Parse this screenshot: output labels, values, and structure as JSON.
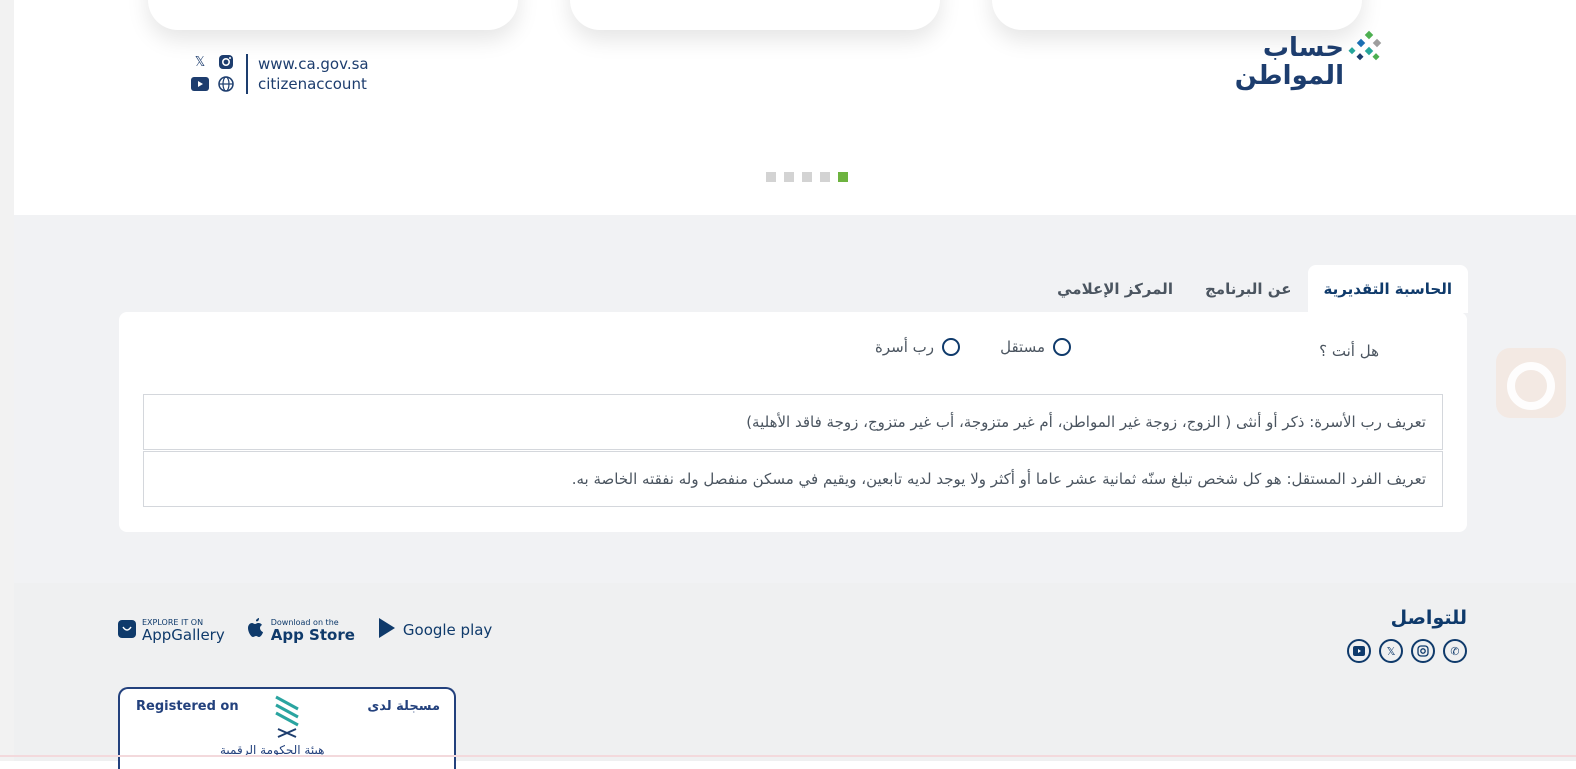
{
  "hero": {
    "brand_logo": {
      "icon": "citizen-account-logo",
      "line1": "حساب",
      "line2": "المواطن"
    },
    "social_links": {
      "icons": [
        "x-icon",
        "instagram-icon",
        "youtube-icon",
        "globe-icon"
      ],
      "url": "www.ca.gov.sa",
      "handle": "citizenaccount"
    },
    "carousel": {
      "count": 5,
      "active_index": 4,
      "active_color": "#6db33f",
      "inactive_color": "#d3d3d3"
    }
  },
  "tabs": {
    "items": [
      {
        "label": "الحاسبة التقديرية",
        "active": true
      },
      {
        "label": "عن البرنامج",
        "active": false
      },
      {
        "label": "المركز الإعلامي",
        "active": false
      }
    ]
  },
  "calculator": {
    "question": "هل أنت ؟",
    "options": [
      {
        "label": "مستقل",
        "selected": false
      },
      {
        "label": "رب أسرة",
        "selected": false
      }
    ],
    "definitions": [
      "تعريف رب الأسرة: ذكر أو أنثى ( الزوج، زوجة غير المواطن، أم غير متزوجة، أب غير متزوج، زوجة فاقد الأهلية)",
      "تعريف الفرد المستقل: هو كل شخص تبلغ سنّه ثمانية عشر عاما أو أكثر ولا يوجد لديه تابعين، ويقيم في مسكن منفصل وله نفقته الخاصة به."
    ]
  },
  "footer": {
    "contact_title": "للتواصل",
    "contact_icons": [
      "phone-icon",
      "instagram-icon",
      "x-icon",
      "youtube-icon"
    ],
    "stores": [
      {
        "name": "AppGallery",
        "small": "EXPLORE IT ON",
        "icon": "huawei-appgallery-icon"
      },
      {
        "name": "App Store",
        "small": "Download on the",
        "icon": "apple-icon"
      },
      {
        "name": "Google play",
        "small": "",
        "icon": "google-play-icon"
      }
    ],
    "registered": {
      "left_label": "Registered on",
      "right_label": "مسجلة لدى",
      "org_name": "هيئة الحكومة الرقمية"
    }
  },
  "colors": {
    "brand_blue": "#0f3a6b",
    "accent_green": "#6db33f",
    "section_bg": "#f1f2f4"
  }
}
